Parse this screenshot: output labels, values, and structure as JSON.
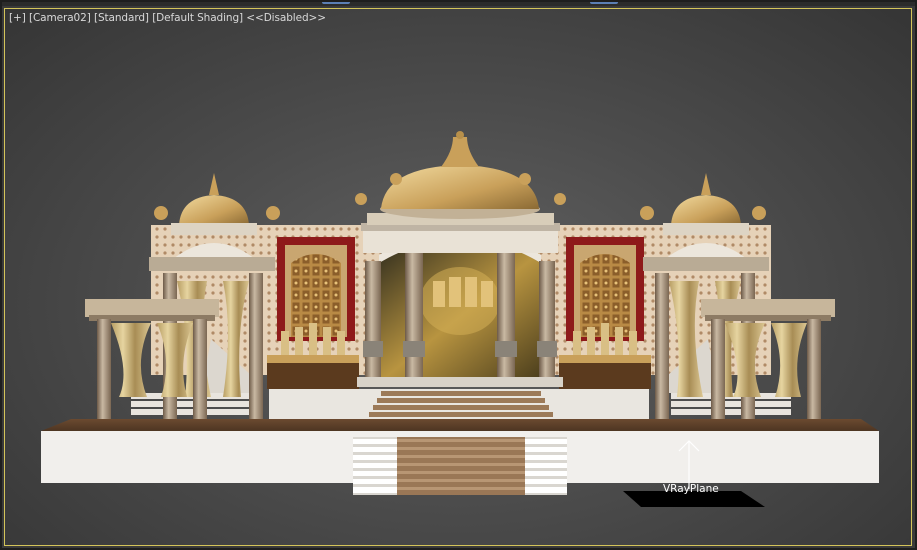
{
  "viewport": {
    "menu": {
      "plus": "[+]",
      "camera": "[Camera02]",
      "mode": "[Standard]",
      "shading": "[Default Shading]",
      "status": "<<Disabled>>"
    },
    "objects": {
      "vray_plane_label": "VRayPlane"
    }
  },
  "colors": {
    "viewport_border": "#d4c45a",
    "gold": "#c9a05a",
    "red_panel": "#8e1a1a",
    "platform": "#f1efec"
  }
}
